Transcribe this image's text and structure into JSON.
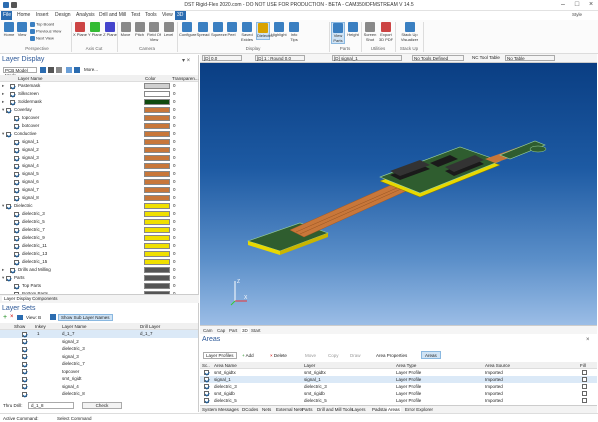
{
  "window": {
    "title": "DST Rigid-Flex 2020.com - DO NOT USE FOR PRODUCTION - BETA - CAM350/DFMSTREAM V 14.5",
    "style_label": "Style"
  },
  "menu": [
    "File",
    "Home",
    "Insert",
    "Design",
    "Analysis",
    "Drill and Mill",
    "Test",
    "Tools",
    "View",
    "3D"
  ],
  "ribbon": {
    "buttons": [
      {
        "label": "Home",
        "group": "Perspective"
      },
      {
        "label": "View",
        "group": "Perspective"
      },
      {
        "label": "Top Board",
        "group": "Perspective"
      },
      {
        "label": "Previous View",
        "group": "Perspective"
      },
      {
        "label": "Next View",
        "group": "Perspective"
      },
      {
        "label": "X Plane",
        "group": "Axis Cut"
      },
      {
        "label": "Y Plane",
        "group": "Axis Cut"
      },
      {
        "label": "Z Plane",
        "group": "Axis Cut"
      },
      {
        "label": "Move",
        "group": "Camera"
      },
      {
        "label": "Pitch",
        "group": "Camera"
      },
      {
        "label": "Field Of View",
        "group": "Camera"
      },
      {
        "label": "Level",
        "group": "Camera"
      },
      {
        "label": "Configure",
        "group": "Display"
      },
      {
        "label": "Spread",
        "group": "Display"
      },
      {
        "label": "Squeeze",
        "group": "Display"
      },
      {
        "label": "Peel",
        "group": "Display"
      },
      {
        "label": "Saved Exides",
        "group": "Display"
      },
      {
        "label": "Dielectric",
        "group": "Display"
      },
      {
        "label": "Highlight",
        "group": "Display"
      },
      {
        "label": "Info Tips",
        "group": "Display"
      },
      {
        "label": "View Parts",
        "group": "Parts"
      },
      {
        "label": "Height",
        "group": "Parts"
      },
      {
        "label": "Screen Shot",
        "group": "Utilities"
      },
      {
        "label": "Export 3D PDF",
        "group": "Utilities"
      },
      {
        "label": "Stack Up Visualizer",
        "group": "Stack Up"
      }
    ],
    "groups": [
      "Perspective",
      "Axis Cut",
      "Camera",
      "Display",
      "Parts",
      "Utilities",
      "Stack Up"
    ]
  },
  "viewbar": {
    "zoom": "[D] 0.0",
    "item1": "[D] 1 : Round 0.0",
    "item2": "[D] signal_1",
    "item3": "No Tools Defined",
    "item4": "NC Tool Table",
    "item5": "No Table"
  },
  "layer_display": {
    "title": "Layer Display",
    "mode": "PCB Model Mode",
    "more": "More...",
    "cols": [
      "Layer Name",
      "Color",
      "Transparen..."
    ],
    "rows": [
      {
        "name": "Pastemask",
        "indent": 1,
        "color": "#cfcfcf",
        "t": "0"
      },
      {
        "name": "Silkscreen",
        "indent": 1,
        "color": "#ffffff",
        "t": "0"
      },
      {
        "name": "Soldermask",
        "indent": 1,
        "color": "#0f4a0f",
        "t": "0"
      },
      {
        "name": "Coverlay",
        "indent": 0,
        "color": "#c8773a",
        "t": "0"
      },
      {
        "name": "topcover",
        "indent": 2,
        "color": "#c8773a",
        "t": "0"
      },
      {
        "name": "botcover",
        "indent": 2,
        "color": "#c8773a",
        "t": "0"
      },
      {
        "name": "Conductive",
        "indent": 0,
        "color": "#c8773a",
        "t": "0"
      },
      {
        "name": "signal_1",
        "indent": 2,
        "color": "#c8773a",
        "t": "0"
      },
      {
        "name": "signal_2",
        "indent": 2,
        "color": "#c8773a",
        "t": "0"
      },
      {
        "name": "signal_3",
        "indent": 2,
        "color": "#c8773a",
        "t": "0"
      },
      {
        "name": "signal_4",
        "indent": 2,
        "color": "#c8773a",
        "t": "0"
      },
      {
        "name": "signal_5",
        "indent": 2,
        "color": "#c8773a",
        "t": "0"
      },
      {
        "name": "signal_6",
        "indent": 2,
        "color": "#c8773a",
        "t": "0"
      },
      {
        "name": "signal_7",
        "indent": 2,
        "color": "#c8773a",
        "t": "0"
      },
      {
        "name": "signal_8",
        "indent": 2,
        "color": "#c8773a",
        "t": "0"
      },
      {
        "name": "Dielectric",
        "indent": 0,
        "color": "#f0e000",
        "t": "0"
      },
      {
        "name": "dielectric_3",
        "indent": 2,
        "color": "#f0e000",
        "t": "0"
      },
      {
        "name": "dielectric_5",
        "indent": 2,
        "color": "#f0e000",
        "t": "0"
      },
      {
        "name": "dielectric_7",
        "indent": 2,
        "color": "#f0e000",
        "t": "0"
      },
      {
        "name": "dielectric_9",
        "indent": 2,
        "color": "#f0e000",
        "t": "0"
      },
      {
        "name": "dielectric_11",
        "indent": 2,
        "color": "#f0e000",
        "t": "0"
      },
      {
        "name": "dielectric_13",
        "indent": 2,
        "color": "#f0e000",
        "t": "0"
      },
      {
        "name": "dielectric_15",
        "indent": 2,
        "color": "#f0e000",
        "t": "0"
      },
      {
        "name": "Drills and Milling",
        "indent": 1,
        "color": "#555555",
        "t": "0"
      },
      {
        "name": "Parts",
        "indent": 0,
        "color": "#555555",
        "t": "0"
      },
      {
        "name": "Top Parts",
        "indent": 2,
        "color": "#555555",
        "t": "0"
      },
      {
        "name": "Bottom Parts",
        "indent": 2,
        "color": "#555555",
        "t": "0"
      }
    ],
    "tabs": [
      "Layer Display",
      "Components"
    ]
  },
  "layer_sets": {
    "title": "Layer Sets",
    "view": "View: B",
    "show_sub": "Show Sub Layer Names",
    "cols": [
      "Show",
      "Inkey",
      "Layer Name",
      "Drill Layer"
    ],
    "rows": [
      {
        "inkey": "1",
        "name": "d_1_7",
        "drill": "d_1_7",
        "sel": true
      },
      {
        "inkey": "",
        "name": "signal_2",
        "drill": ""
      },
      {
        "inkey": "",
        "name": "dielectric_3",
        "drill": ""
      },
      {
        "inkey": "",
        "name": "signal_3",
        "drill": ""
      },
      {
        "inkey": "",
        "name": "dielectric_7",
        "drill": ""
      },
      {
        "inkey": "",
        "name": "topcover",
        "drill": ""
      },
      {
        "inkey": "",
        "name": "smt_rigidt",
        "drill": ""
      },
      {
        "inkey": "",
        "name": "signal_4",
        "drill": ""
      },
      {
        "inkey": "",
        "name": "dielectric_8",
        "drill": ""
      }
    ],
    "thru_drill_label": "Thru Drill:",
    "thru_drill_value": "d_1_8",
    "check": "Check"
  },
  "vp_tabs": [
    "Cam",
    "Cap",
    "Part",
    "3D",
    "Start"
  ],
  "areas": {
    "title": "Areas",
    "toolbar": [
      "Layer Profiles",
      "Add",
      "Delete",
      "Move",
      "Copy",
      "Draw",
      "Area Properties",
      "Areas"
    ],
    "cols": [
      "Sc..",
      "Area Name",
      "Layer",
      "Area Type",
      "Area Source",
      "Fill"
    ],
    "rows": [
      {
        "name": "smt_rigidtx",
        "layer": "smt_rigidtx",
        "type": "Layer Profile",
        "src": "Imported"
      },
      {
        "name": "signal_1",
        "layer": "signal_1",
        "type": "Layer Profile",
        "src": "Imported"
      },
      {
        "name": "dielectric_3",
        "layer": "dielectric_3",
        "type": "Layer Profile",
        "src": "Imported"
      },
      {
        "name": "smt_rigidb",
        "layer": "smt_rigidb",
        "type": "Layer Profile",
        "src": "Imported"
      },
      {
        "name": "dielectric_5",
        "layer": "dielectric_5",
        "type": "Layer Profile",
        "src": "Imported"
      }
    ],
    "bottom_tabs": [
      "System Messages",
      "DCodes",
      "Nets",
      "External Nets",
      "Parts",
      "Drill and Mill Tools",
      "Layers",
      "Padstacks",
      "Areas",
      "Error Explorer"
    ]
  },
  "status": {
    "mode": "Active Command:",
    "cmd": "Select Command"
  },
  "colors": {
    "accent": "#2b6cb0",
    "viewport_top": "#0a3e83",
    "viewport_bottom": "#9bbde6"
  }
}
